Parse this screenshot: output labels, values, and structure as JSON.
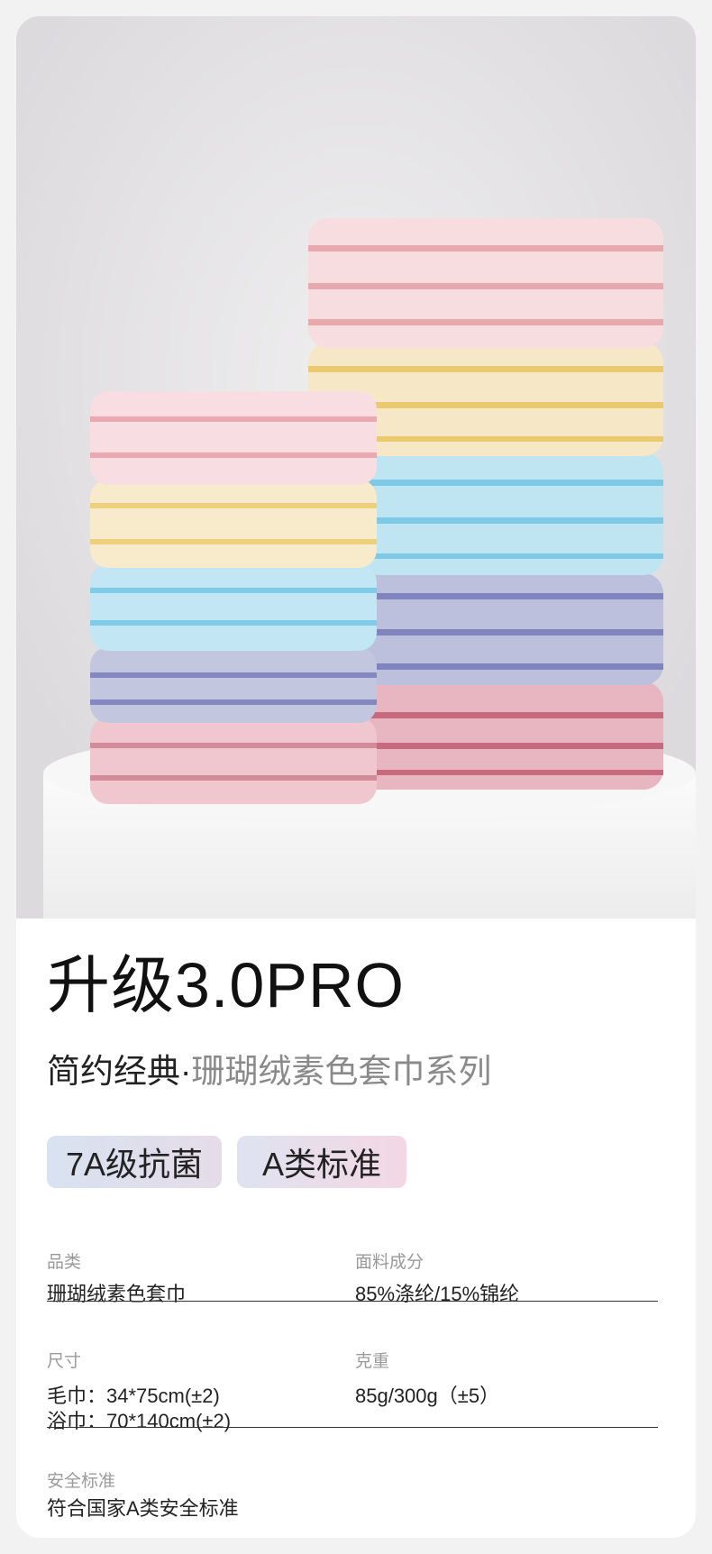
{
  "hero": {
    "alt_icon": "product-photo"
  },
  "headline": {
    "title": "升级3.0PRO",
    "subtitle_dark": "简约经典·",
    "subtitle_light": "珊瑚绒素色套巾系列"
  },
  "badges": [
    "7A级抗菌",
    "A类标准"
  ],
  "specs": {
    "category_label": "品类",
    "category_value": "珊瑚绒素色套巾",
    "material_label": "面料成分",
    "material_value": "85%涤纶/15%锦纶",
    "size_label": "尺寸",
    "size_value_1": "毛巾：34*75cm(±2)",
    "size_value_2": "浴巾：70*140cm(±2)",
    "weight_label": "克重",
    "weight_value": "85g/300g（±5）",
    "safety_label": "安全标准",
    "safety_value": "符合国家A类安全标准"
  },
  "colors": {
    "pink": "#f3d3d8",
    "yellow": "#f6e8c7",
    "blue": "#bfe4f2",
    "lavender": "#bcc0dc",
    "rose": "#e8b6c1"
  }
}
